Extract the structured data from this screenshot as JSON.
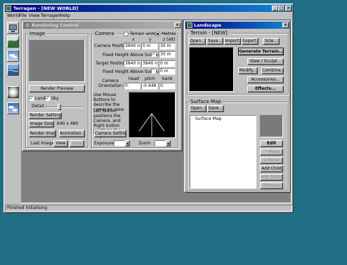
{
  "app": {
    "title": "Terragen - [NEW WORLD]",
    "menu": [
      "World",
      "File",
      "View",
      "Terragen",
      "Help"
    ],
    "status": "Finished Initialising"
  },
  "render_control": {
    "title": "Rendering Control",
    "image_group": "Image",
    "render_preview": "Render Preview",
    "land_label": "Land",
    "sky_label": "Sky",
    "land_checked": true,
    "sky_checked": true,
    "detail_label": "Detail",
    "render_settings": "Render Settings...",
    "image_size_btn": "Image Size...",
    "image_size_value": "640 x 480",
    "render_image": "Render Image",
    "animation": "Animation...",
    "last_image": "Last Image:",
    "view": "View",
    "save": "Save",
    "camera_group": "Camera",
    "terrain_units": "Terrain units",
    "metres": "Metres",
    "col_x": "x",
    "col_y": "y",
    "col_z": "z (alt)",
    "camera_position": "Camera Position",
    "cam_x": "3840 m",
    "cam_y": "0 m",
    "cam_z": "30 m",
    "fixed_height_label": "Fixed Height Above Surface",
    "cam_fixed_height": "30 m",
    "target_position": "Target Position",
    "tgt_x": "3840 m",
    "tgt_y": "3840 m",
    "tgt_z": "0 m",
    "tgt_fixed_height": "0 m",
    "col_head": "head",
    "col_pitch": "pitch",
    "col_bank": "bank",
    "camera_orientation": "Camera Orientation",
    "head": "0.",
    "pitch": "-0.448",
    "bank": "0.",
    "mouse_help_1": "Use Mouse Buttons to describe the camera's view.",
    "mouse_help_2": "Left button positions the Camera, and Right button positions the Target.",
    "camera_settings": "Camera Settings...",
    "exposure": "Exposure",
    "zoom": "Zoom"
  },
  "landscape": {
    "title": "Landscape",
    "terrain_group": "Terrain - [NEW]",
    "open": "Open...",
    "save": "Save...",
    "import": "Import...",
    "export": "Export...",
    "size": "Size...",
    "generate_terrain": "Generate Terrain...",
    "view_sculpt": "View / Sculpt...",
    "modify": "Modify...",
    "combine": "Combine...",
    "accessories": "Accessories...",
    "effects": "Effects...",
    "surface_group": "Surface Map",
    "surf_open": "Open...",
    "surf_save": "Save...",
    "tree_root": "Surface Map",
    "edit": "Edit",
    "move_up": "^ Move",
    "move_down": "v Move",
    "add_child": "Add Child",
    "add_sibling": "Add Sibling",
    "remove": "Remove"
  },
  "icons": [
    "render-icon",
    "landscape-icon",
    "sky-icon",
    "water-icon",
    "sun-icon",
    "cloud-icon"
  ],
  "colors": {
    "titlebar": "#000080",
    "desktop": "#1f6e84",
    "panel": "#c0c0c0"
  }
}
